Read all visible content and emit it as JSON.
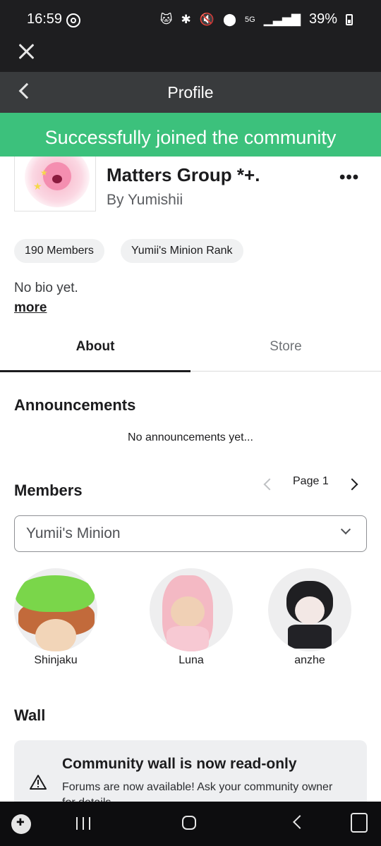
{
  "status_bar": {
    "time": "16:59",
    "network": "5G",
    "battery": "39%"
  },
  "header": {
    "title": "Profile"
  },
  "toast": {
    "message": "Successfully joined the community"
  },
  "group": {
    "name": "Matters Group *+.",
    "owner": "By Yumishii",
    "members_chip": "190 Members",
    "rank_chip": "Yumii's Minion Rank",
    "bio": "No bio yet.",
    "more_link": "more",
    "more_menu_icon": "•••"
  },
  "tabs": [
    {
      "label": "About",
      "active": true
    },
    {
      "label": "Store",
      "active": false
    }
  ],
  "announcements": {
    "title": "Announcements",
    "empty_text": "No announcements yet..."
  },
  "members": {
    "title": "Members",
    "page_label": "Page 1",
    "role_select": "Yumii's Minion",
    "list": [
      {
        "name": "Shinjaku"
      },
      {
        "name": "Luna"
      },
      {
        "name": "anzhe"
      }
    ]
  },
  "wall": {
    "title": "Wall",
    "banner_title": "Community wall is now read-only",
    "banner_body": "Forums are now available! Ask your community owner for details."
  },
  "colors": {
    "toast_green": "#3cc17c",
    "header_bg": "#393b3d",
    "status_bg": "#1e1e20"
  },
  "icons": [
    "close-icon",
    "back-icon",
    "more-icon",
    "chevron-left-icon",
    "chevron-right-icon",
    "chevron-down-icon",
    "warning-icon"
  ]
}
